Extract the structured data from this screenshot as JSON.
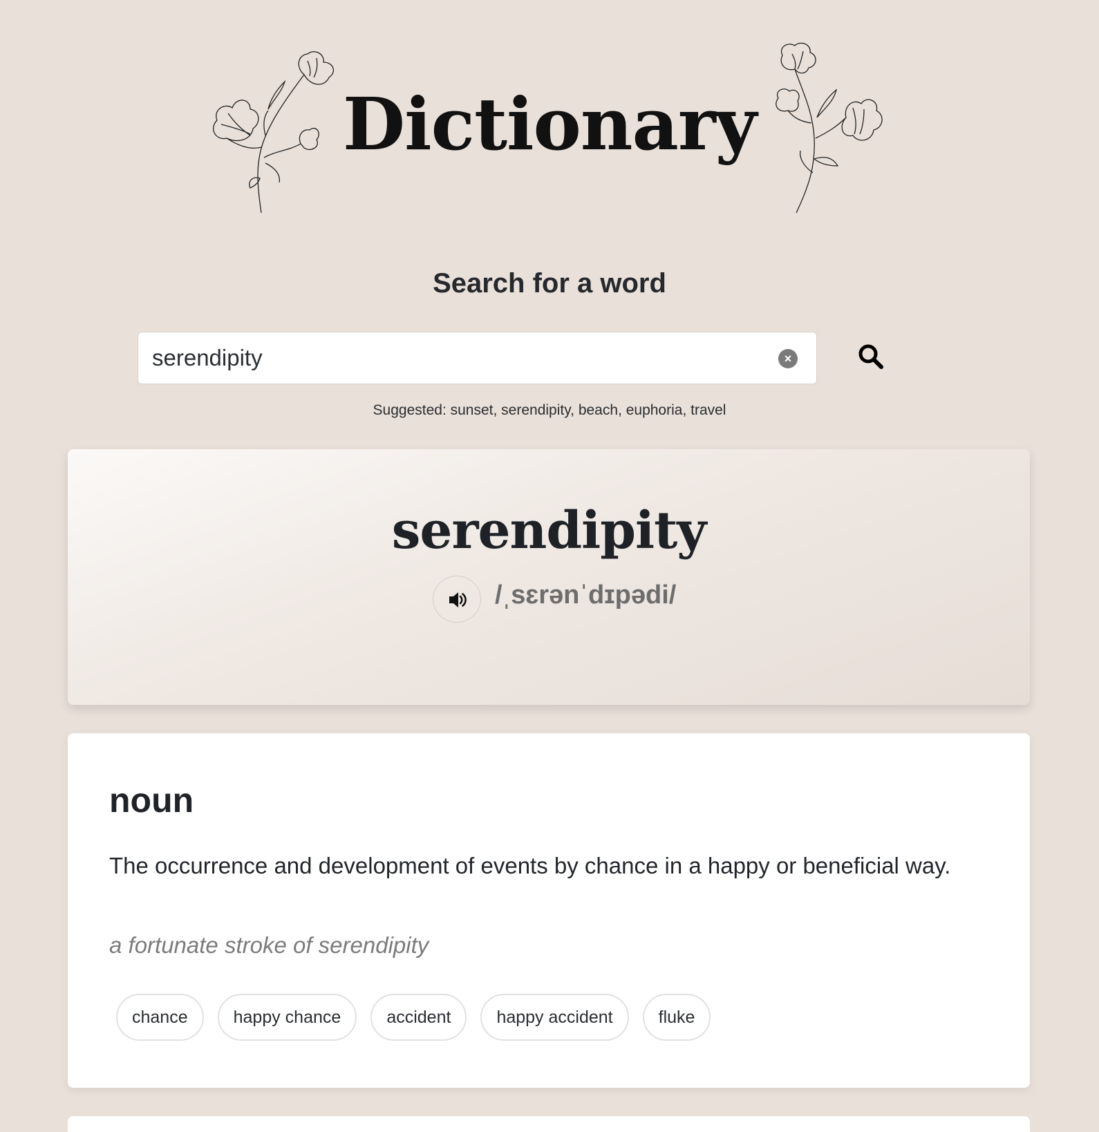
{
  "header": {
    "title": "Dictionary",
    "decoration_icons": [
      "flower-icon",
      "flower-icon"
    ]
  },
  "search": {
    "heading": "Search for a word",
    "value": "serendipity",
    "placeholder": "",
    "clear_icon": "close-circle-icon",
    "search_icon": "search-icon",
    "suggested": "Suggested: sunset, serendipity, beach, euphoria, travel"
  },
  "entry": {
    "word": "serendipity",
    "phonetic": "/ˌsɛrənˈdɪpədi/",
    "audio_icon": "speaker-icon"
  },
  "meanings": [
    {
      "part_of_speech": "noun",
      "definition": "The occurrence and development of events by chance in a happy or beneficial way.",
      "example": "a fortunate stroke of serendipity",
      "synonyms": [
        "chance",
        "happy chance",
        "accident",
        "happy accident",
        "fluke"
      ]
    }
  ],
  "colors": {
    "background": "#e9e0d9",
    "card": "#ffffff",
    "text": "#22262b",
    "muted": "#7b7b7b"
  }
}
